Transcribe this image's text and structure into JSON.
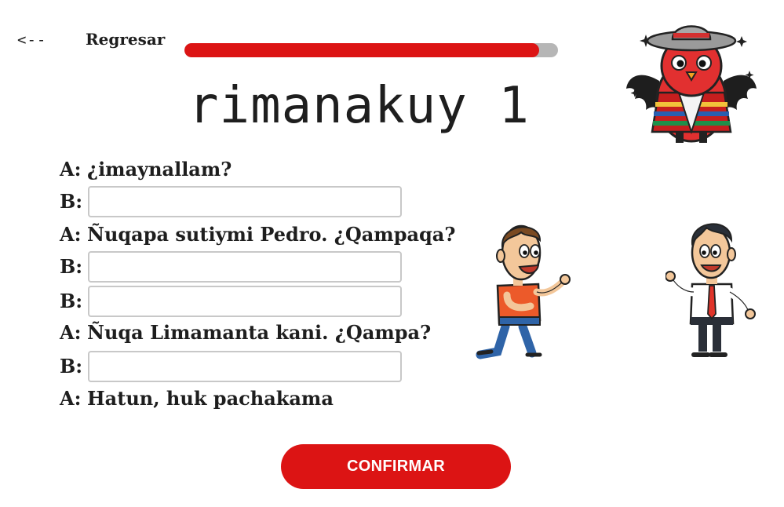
{
  "nav": {
    "back_arrow": "<--",
    "back_label": "Regresar"
  },
  "progress": {
    "fraction": 0.95,
    "fill_color": "#dc1414",
    "track_color": "#b6b6b6"
  },
  "page_title": "rimanakuy 1",
  "dialogue": [
    {
      "speaker": "A:",
      "text": "¿imaynallam?"
    },
    {
      "speaker": "B:",
      "input_value": ""
    },
    {
      "speaker": "A:",
      "text": "Ñuqapa sutiymi Pedro. ¿Qampaqa?"
    },
    {
      "speaker": "B:",
      "input_value": ""
    },
    {
      "speaker": "B:",
      "input_value": ""
    },
    {
      "speaker": "A:",
      "text": "Ñuqa Limamanta kani. ¿Qampa?"
    },
    {
      "speaker": "B:",
      "input_value": ""
    },
    {
      "speaker": "A:",
      "text": "Hatun, huk pachakama"
    }
  ],
  "confirm_label": "CONFIRMAR",
  "colors": {
    "accent": "#dc1414"
  },
  "icons": {
    "mascot": "bird-mascot-icon",
    "person_a": "person-orange-shirt-icon",
    "person_b": "person-tie-icon"
  }
}
